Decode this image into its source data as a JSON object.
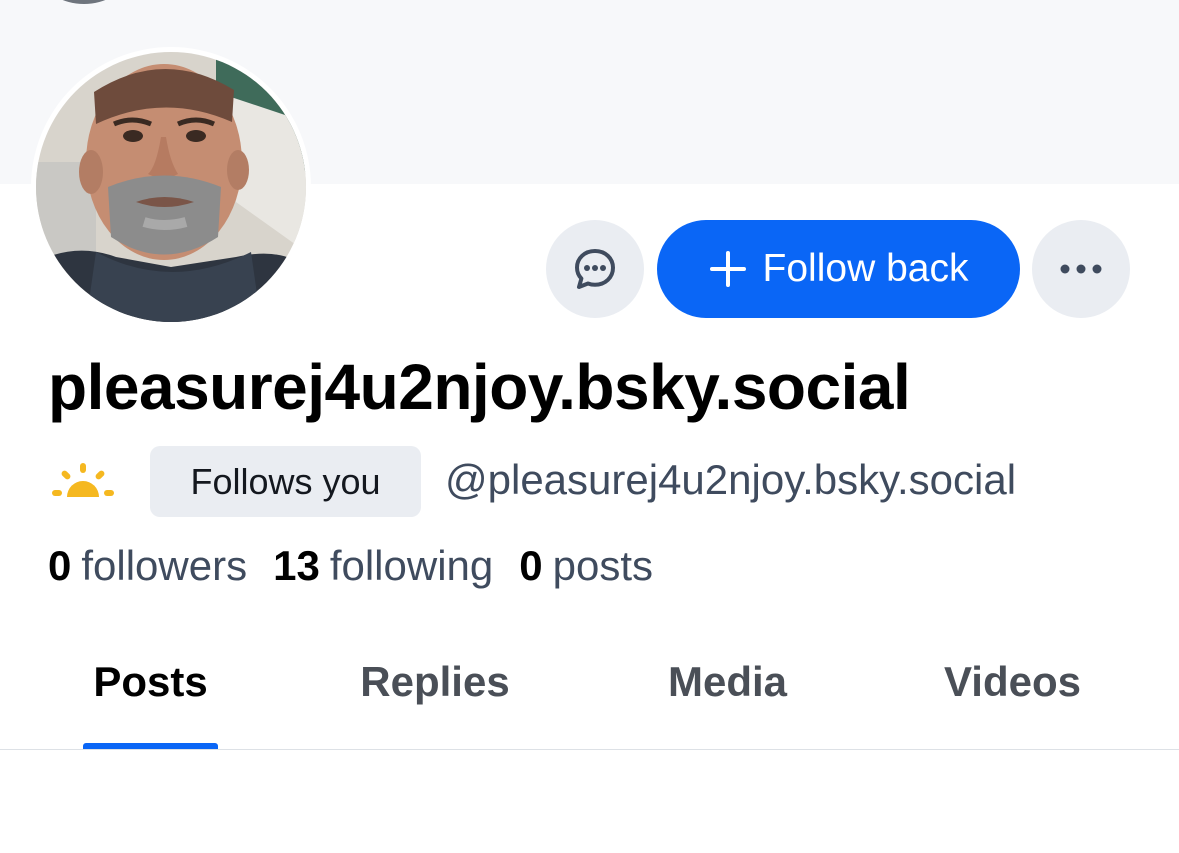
{
  "profile": {
    "display_name": "pleasurej4u2njoy.bsky.social",
    "handle": "@pleasurej4u2njoy.bsky.social",
    "follows_you_label": "Follows you",
    "avatar_icon": "profile-photo",
    "status_emoji_icon": "sunrise-icon"
  },
  "actions": {
    "message_icon": "message-icon",
    "follow_label": "Follow back",
    "follow_icon": "plus-icon",
    "more_icon": "ellipsis-icon"
  },
  "stats": {
    "followers": {
      "count": "0",
      "label": "followers"
    },
    "following": {
      "count": "13",
      "label": "following"
    },
    "posts": {
      "count": "0",
      "label": "posts"
    }
  },
  "tabs": [
    {
      "label": "Posts",
      "active": true
    },
    {
      "label": "Replies",
      "active": false
    },
    {
      "label": "Media",
      "active": false
    },
    {
      "label": "Videos",
      "active": false
    }
  ],
  "colors": {
    "accent": "#0a66f6",
    "secondary_button_bg": "#eaedf2",
    "muted_text": "#3f4b5e",
    "banner_bg": "#f7f8fa",
    "emoji_yellow": "#f5b820"
  }
}
